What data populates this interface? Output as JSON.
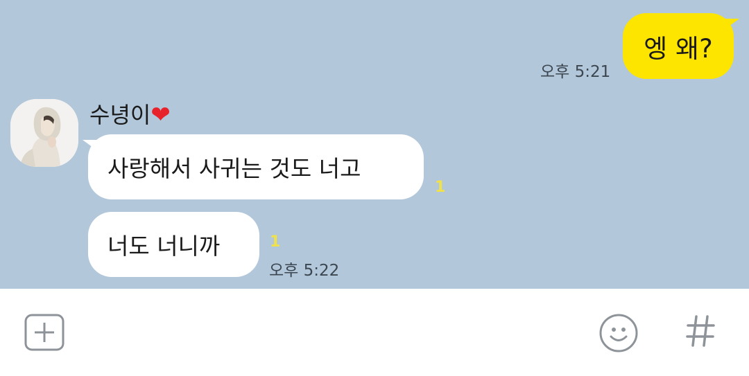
{
  "messages": {
    "outgoing": {
      "text": "엥 왜?",
      "time": "오후 5:21"
    },
    "incoming": {
      "sender": "수녕이",
      "sender_emoji": "❤",
      "bubbles": [
        {
          "text": "사랑해서 사귀는 것도 너고",
          "unread": "1"
        },
        {
          "text": "너도 너니까",
          "unread": "1"
        }
      ],
      "time": "오후 5:22"
    }
  },
  "input_bar": {
    "icons": [
      "plus-icon",
      "emoji-icon",
      "hash-icon"
    ],
    "hash_glyph": "#"
  },
  "colors": {
    "chat_background": "#b2c7da",
    "outgoing_bubble": "#fee500",
    "incoming_bubble": "#ffffff",
    "unread_count": "#f2e24a",
    "input_bar_background": "#ffffff"
  }
}
